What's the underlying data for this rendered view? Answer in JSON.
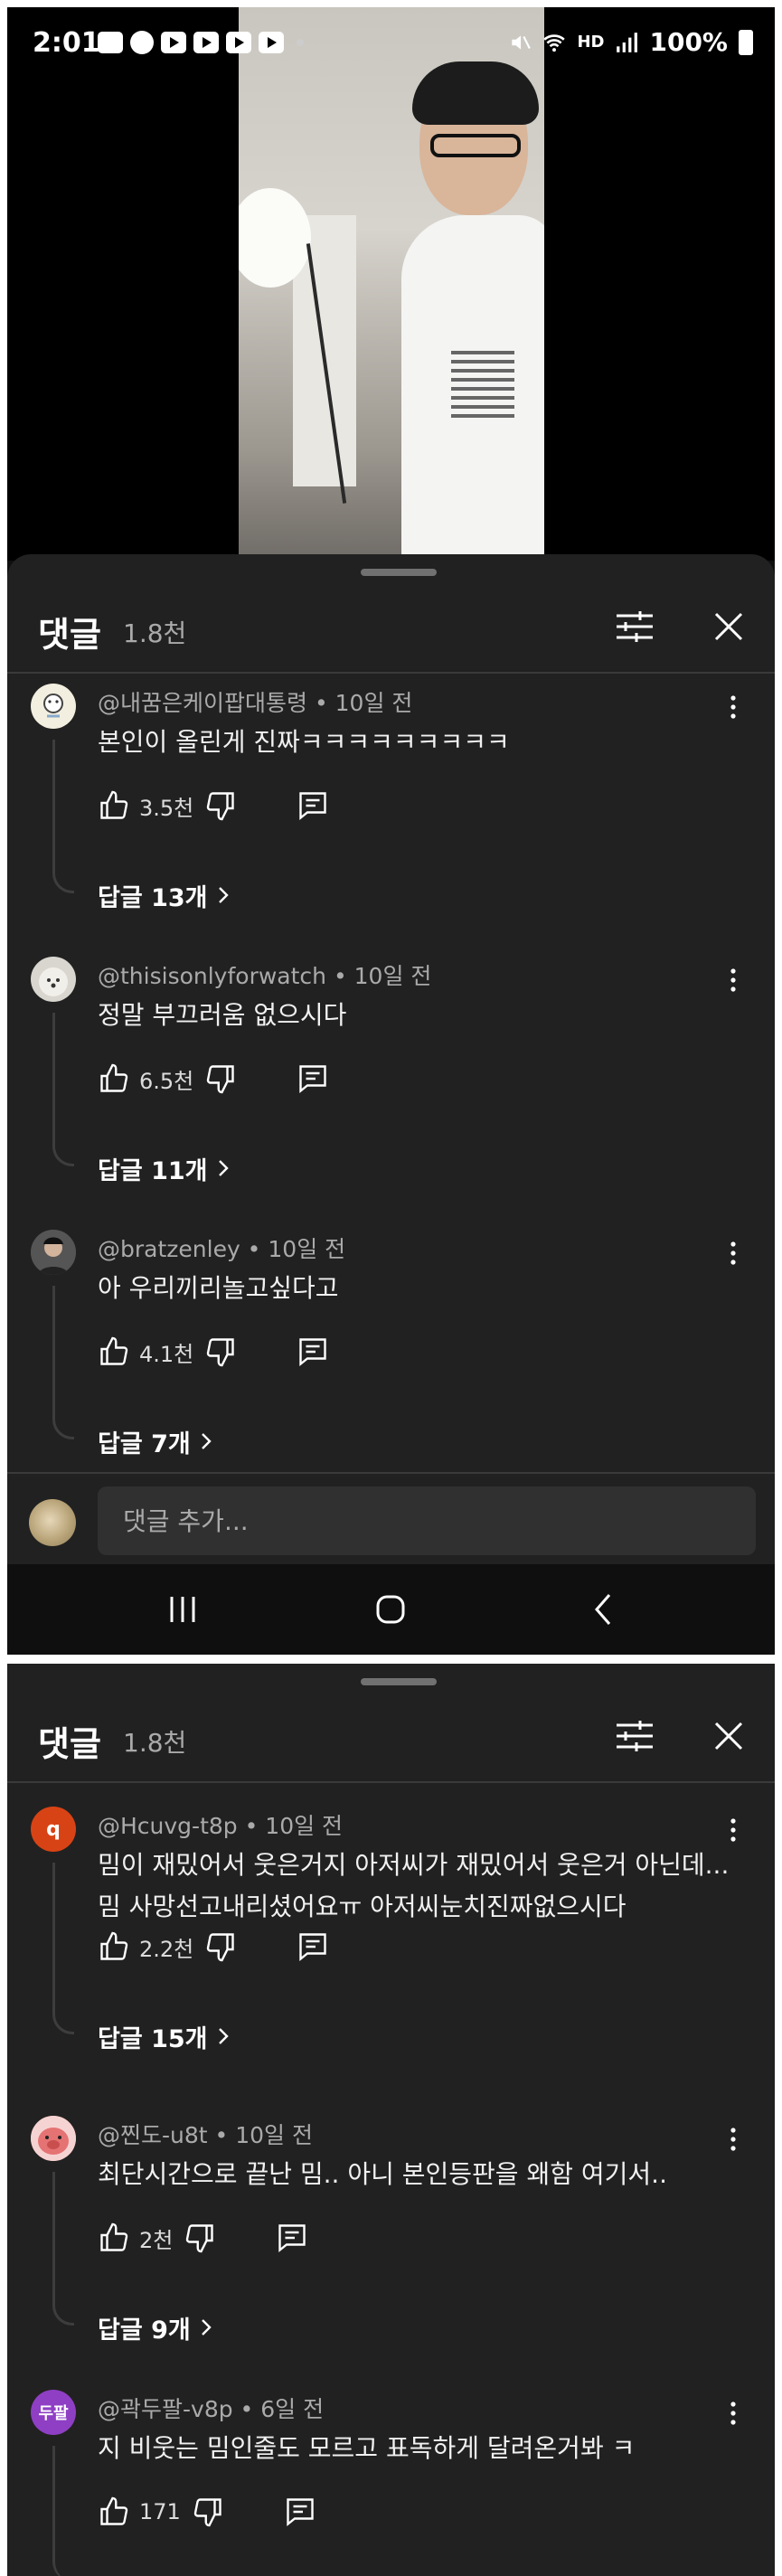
{
  "status_bar": {
    "time": "2:01",
    "battery": "100%",
    "network_label": "HD",
    "notification_icons": [
      "talk-icon",
      "chat-icon",
      "youtube-icon",
      "youtube-icon",
      "youtube-icon",
      "youtube-icon"
    ]
  },
  "sheet": {
    "title": "댓글",
    "count": "1.8천"
  },
  "panel1_comments": [
    {
      "author": "@내꿈은케이팝대통령 • 10일 전",
      "text": "본인이 올린게 진짜ㅋㅋㅋㅋㅋㅋㅋㅋㅋ",
      "likes": "3.5천",
      "replies": "답글 13개"
    },
    {
      "author": "@thisisonlyforwatch • 10일 전",
      "text": "정말 부끄러움 없으시다",
      "likes": "6.5천",
      "replies": "답글 11개"
    },
    {
      "author": "@bratzenley • 10일 전",
      "text": "아 우리끼리놀고싶다고",
      "likes": "4.1천",
      "replies": "답글 7개"
    }
  ],
  "comment_input": {
    "placeholder": "댓글 추가..."
  },
  "panel2_comments": [
    {
      "avatar_letter": "q",
      "author": "@Hcuvg-t8p • 10일 전",
      "text": "밈이 재밌어서 웃은거지 아저씨가 재밌어서 웃은거 아닌데... 밈 사망선고내리셨어요ㅠ 아저씨눈치진짜없으시다",
      "likes": "2.2천",
      "replies": "답글 15개"
    },
    {
      "author": "@찐도-u8t • 10일 전",
      "text": "최단시간으로 끝난 밈.. 아니 본인등판을 왜함 여기서..",
      "likes": "2천",
      "replies": "답글 9개"
    },
    {
      "avatar_letter": "두팔",
      "author": "@곽두팔-v8p • 6일 전",
      "text": "지 비웃는 밈인줄도 모르고 표독하게 달려온거봐 ㅋ",
      "likes": "171"
    }
  ],
  "colors": {
    "sheet_bg": "#212121",
    "avatar_q": "#d84315",
    "avatar_dupal": "#8e3fc4",
    "avatar_pig": "#e57373"
  }
}
